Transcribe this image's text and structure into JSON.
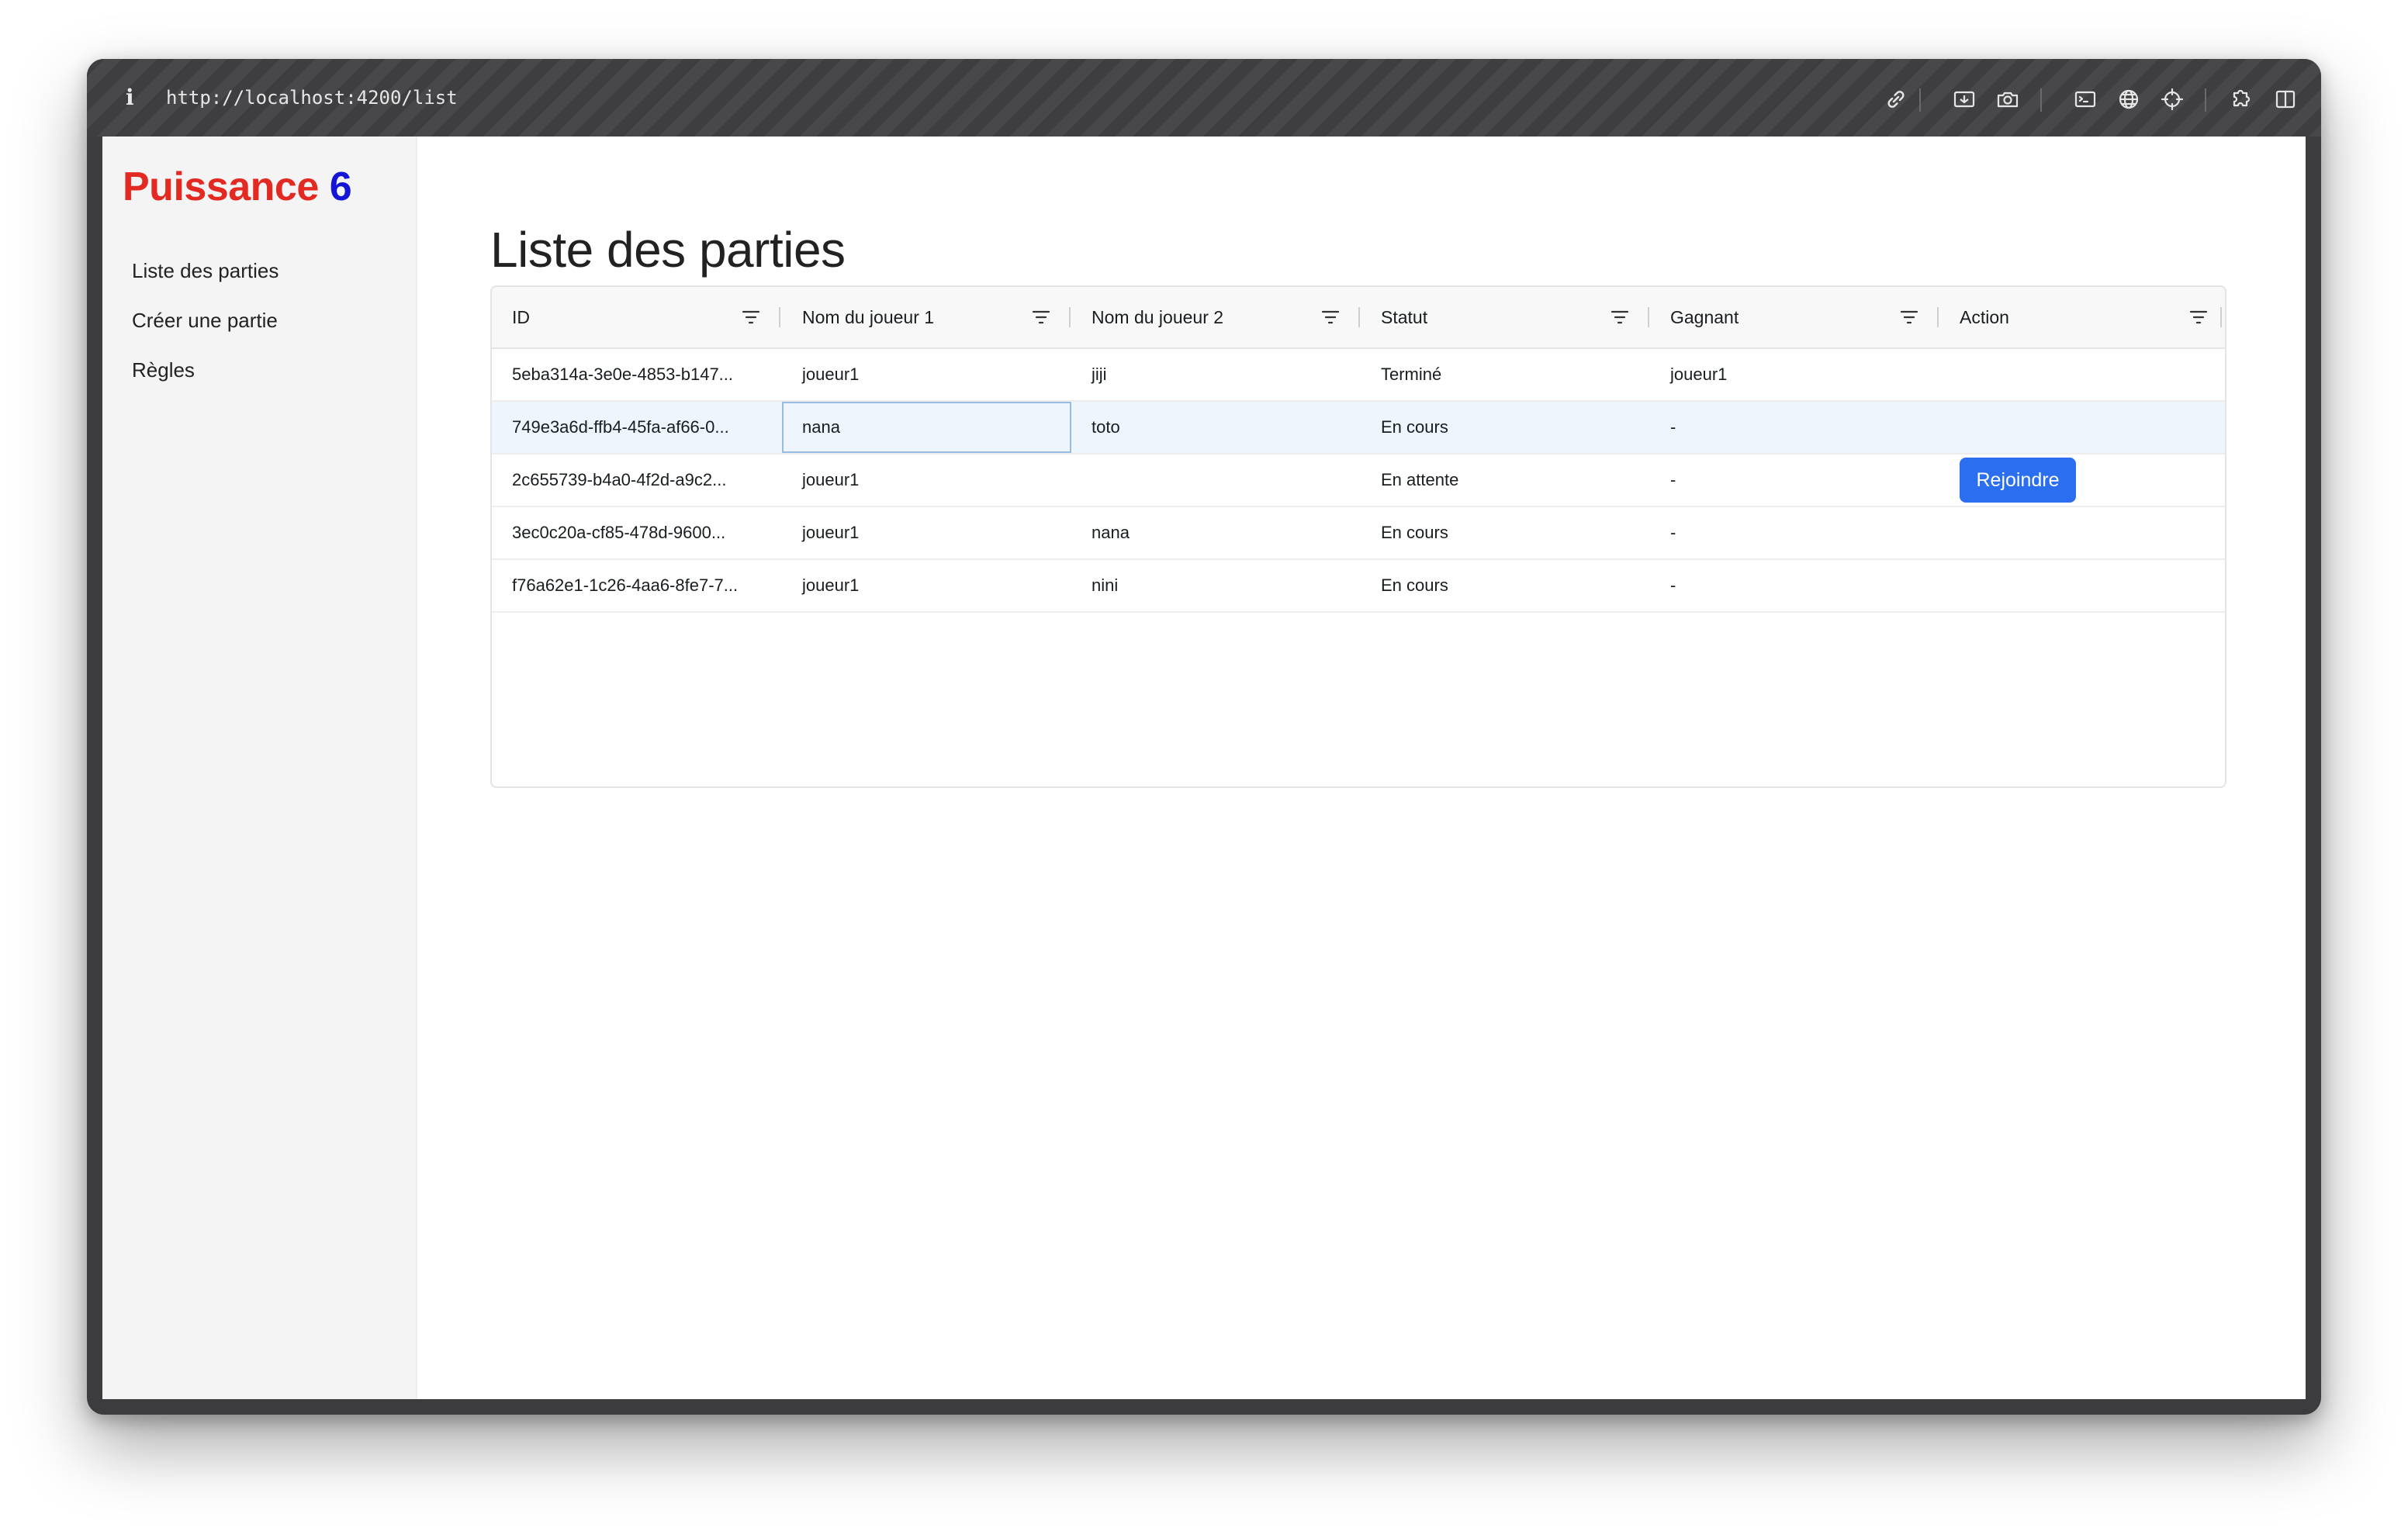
{
  "browser": {
    "info_glyph": "i",
    "url": "http://localhost:4200/list",
    "toolbar_icons": [
      "link-icon",
      "screenshot-icon",
      "camera-icon",
      "terminal-icon",
      "globe-icon",
      "crosshair-icon",
      "extensions-icon",
      "sidebar-toggle-icon"
    ]
  },
  "sidebar": {
    "brand_part1": "Puissance",
    "brand_part2": "6",
    "brand_colors": {
      "part1": "#e32a22",
      "part2": "#1414d6"
    },
    "nav": [
      {
        "label": "Liste des parties"
      },
      {
        "label": "Créer une partie"
      },
      {
        "label": "Règles"
      }
    ]
  },
  "main": {
    "title": "Liste des parties"
  },
  "table": {
    "columns": [
      "ID",
      "Nom du joueur 1",
      "Nom du joueur 2",
      "Statut",
      "Gagnant",
      "Action"
    ],
    "filter_icon": "filter-icon",
    "rows": [
      {
        "id": "5eba314a-3e0e-4853-b147...",
        "player1": "joueur1",
        "player2": "jiji",
        "status": "Terminé",
        "winner": "joueur1",
        "action": ""
      },
      {
        "id": "749e3a6d-ffb4-45fa-af66-0...",
        "player1": "nana",
        "player2": "toto",
        "status": "En cours",
        "winner": "-",
        "action": ""
      },
      {
        "id": "2c655739-b4a0-4f2d-a9c2...",
        "player1": "joueur1",
        "player2": "",
        "status": "En attente",
        "winner": "-",
        "action": "Rejoindre"
      },
      {
        "id": "3ec0c20a-cf85-478d-9600...",
        "player1": "joueur1",
        "player2": "nana",
        "status": "En cours",
        "winner": "-",
        "action": ""
      },
      {
        "id": "f76a62e1-1c26-4aa6-8fe7-7...",
        "player1": "joueur1",
        "player2": "nini",
        "status": "En cours",
        "winner": "-",
        "action": ""
      }
    ],
    "selected_row": 1,
    "accent_color": "#2b6ff0"
  }
}
